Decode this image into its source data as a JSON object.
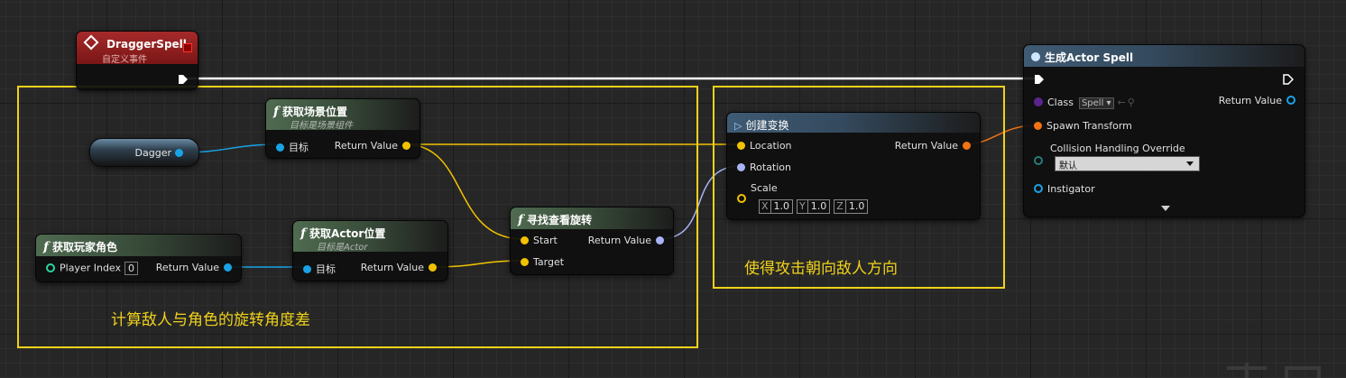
{
  "colors": {
    "comment": "#f0d21a",
    "exec_wire": "#ffffff",
    "vector_wire": "#f2c200",
    "object_wire": "#19a3e6",
    "rotator_wire": "#a9b3f5",
    "transform_wire": "#f07314",
    "event_header": "#a62a2a",
    "function_header": "#4f6b50",
    "spawn_header": "#3f5a73"
  },
  "comments": {
    "left": "计算敌人与角色的旋转角度差",
    "right": "使得攻击朝向敌人方向"
  },
  "event_node": {
    "title": "DraggerSpell",
    "subtitle": "自定义事件",
    "icon": "event-diamond-icon"
  },
  "dagger_var": {
    "label": "Dagger"
  },
  "get_world_location": {
    "title": "获取场景位置",
    "subtitle": "目标是场景组件",
    "target_label": "目标",
    "return_label": "Return Value"
  },
  "get_player_character": {
    "title": "获取玩家角色",
    "player_index_label": "Player Index",
    "player_index_value": "0",
    "return_label": "Return Value"
  },
  "get_actor_location": {
    "title": "获取Actor位置",
    "subtitle": "目标是Actor",
    "target_label": "目标",
    "return_label": "Return Value"
  },
  "find_look_at": {
    "title": "寻找查看旋转",
    "start_label": "Start",
    "target_label": "Target",
    "return_label": "Return Value"
  },
  "make_transform": {
    "title": "创建变换",
    "location_label": "Location",
    "rotation_label": "Rotation",
    "scale_label": "Scale",
    "return_label": "Return Value",
    "scale": {
      "x_label": "X",
      "x": "1.0",
      "y_label": "Y",
      "y": "1.0",
      "z_label": "Z",
      "z": "1.0"
    }
  },
  "spawn_actor": {
    "title": "生成Actor Spell",
    "class_label": "Class",
    "class_value": "Spell",
    "spawn_transform_label": "Spawn Transform",
    "collision_label": "Collision Handling Override",
    "collision_value": "默认",
    "instigator_label": "Instigator",
    "return_label": "Return Value"
  }
}
